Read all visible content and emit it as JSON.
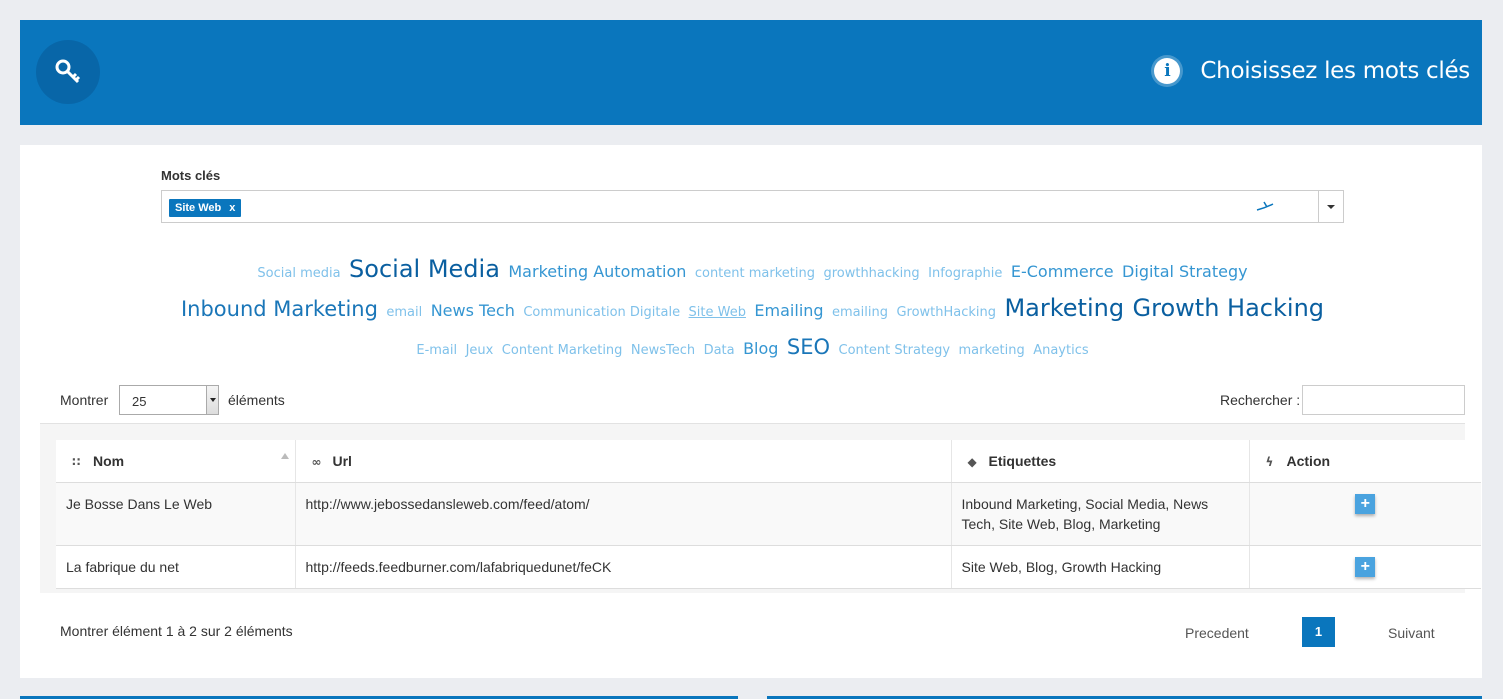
{
  "header": {
    "title": "Choisissez les mots clés",
    "key_icon": "key-icon",
    "info_icon": "info-icon",
    "info_glyph": "i"
  },
  "keywords": {
    "label": "Mots clés",
    "selected_tag": "Site Web",
    "tag_remove": "x"
  },
  "cloud": [
    {
      "text": "Social media",
      "size": 1
    },
    {
      "text": "Social Media",
      "size": 4
    },
    {
      "text": "Marketing Automation",
      "size": 2
    },
    {
      "text": "content marketing",
      "size": 1
    },
    {
      "text": "growthhacking",
      "size": 1
    },
    {
      "text": "Infographie",
      "size": 1
    },
    {
      "text": "E-Commerce",
      "size": 2
    },
    {
      "text": "Digital Strategy",
      "size": 2
    },
    {
      "text": "Inbound Marketing",
      "size": 3
    },
    {
      "text": "email",
      "size": 1
    },
    {
      "text": "News Tech",
      "size": 2
    },
    {
      "text": "Communication Digitale",
      "size": 1
    },
    {
      "text": "Site Web",
      "size": 1,
      "underline": true
    },
    {
      "text": "Emailing",
      "size": 2
    },
    {
      "text": "emailing",
      "size": 1
    },
    {
      "text": "GrowthHacking",
      "size": 1
    },
    {
      "text": "Marketing",
      "size": 4
    },
    {
      "text": "Growth Hacking",
      "size": 4
    },
    {
      "text": "E-mail",
      "size": 1
    },
    {
      "text": "Jeux",
      "size": 1
    },
    {
      "text": "Content Marketing",
      "size": 1
    },
    {
      "text": "NewsTech",
      "size": 1
    },
    {
      "text": "Data",
      "size": 1
    },
    {
      "text": "Blog",
      "size": 2
    },
    {
      "text": "SEO",
      "size": 3
    },
    {
      "text": "Content Strategy",
      "size": 1
    },
    {
      "text": "marketing",
      "size": 1
    },
    {
      "text": "Anaytics",
      "size": 1
    }
  ],
  "table_controls": {
    "show_label": "Montrer",
    "page_length": "25",
    "elements_label": "éléments",
    "search_label": "Rechercher :"
  },
  "table": {
    "columns": [
      {
        "label": "Nom",
        "icon": "rss-icon",
        "glyph": "∷"
      },
      {
        "label": "Url",
        "icon": "link-icon",
        "glyph": "∞"
      },
      {
        "label": "Etiquettes",
        "icon": "tags-icon",
        "glyph": "◆"
      },
      {
        "label": "Action",
        "icon": "bolt-icon",
        "glyph": "ϟ"
      }
    ],
    "rows": [
      {
        "name": "Je Bosse Dans Le Web",
        "url": "http://www.jebossedansleweb.com/feed/atom/",
        "tags": "Inbound Marketing, Social Media, News Tech, Site Web, Blog, Marketing",
        "action": "+"
      },
      {
        "name": "La fabrique du net",
        "url": "http://feeds.feedburner.com/lafabriquedunet/feCK",
        "tags": "Site Web, Blog, Growth Hacking",
        "action": "+"
      }
    ]
  },
  "pagination": {
    "info": "Montrer élément 1 à 2 sur 2 éléments",
    "previous": "Precedent",
    "current": "1",
    "next": "Suivant"
  },
  "colors": {
    "brand": "#0a76bd",
    "page_bg": "#ebedf1"
  }
}
